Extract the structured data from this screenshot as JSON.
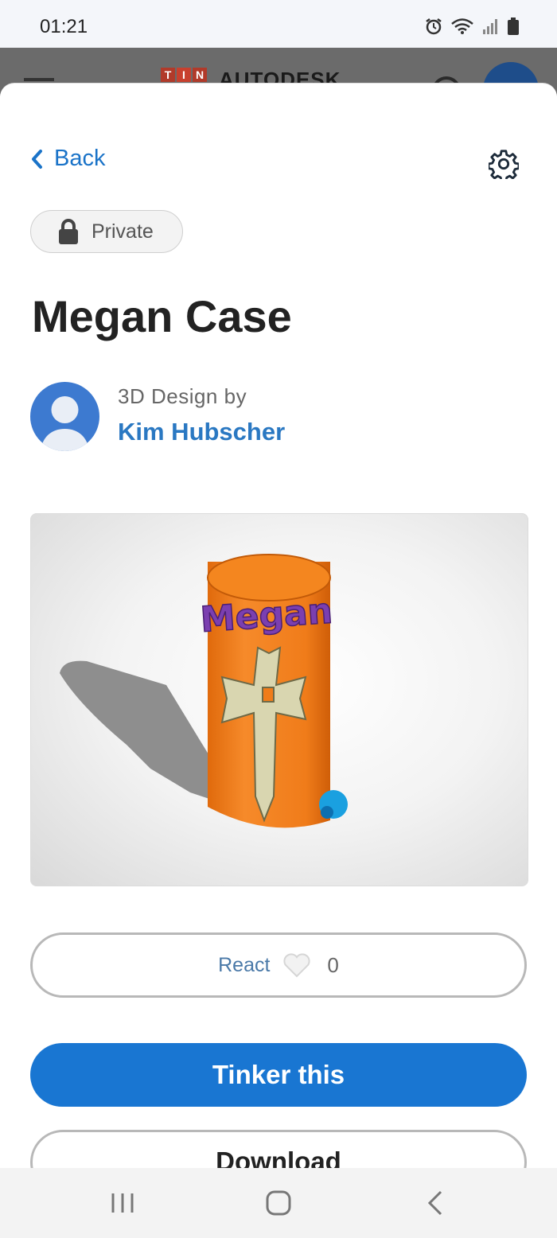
{
  "status_bar": {
    "time": "01:21",
    "icons": [
      "alarm-icon",
      "wifi-icon",
      "signal-icon",
      "battery-icon"
    ]
  },
  "app_header": {
    "logo_letters": [
      "T",
      "I",
      "N"
    ],
    "brand": "AUTODESK"
  },
  "sheet": {
    "back_label": "Back",
    "privacy_label": "Private",
    "title": "Megan Case",
    "byline": "3D Design by",
    "author": "Kim Hubscher",
    "preview_text": "Megan",
    "react_label": "React",
    "react_count": "0",
    "tinker_label": "Tinker this",
    "download_label": "Download"
  },
  "colors": {
    "accent": "#1976d2",
    "link": "#2a78c2",
    "model_orange": "#f07c1a",
    "model_purple": "#7b3fb0",
    "model_blue": "#1aa0e0"
  }
}
